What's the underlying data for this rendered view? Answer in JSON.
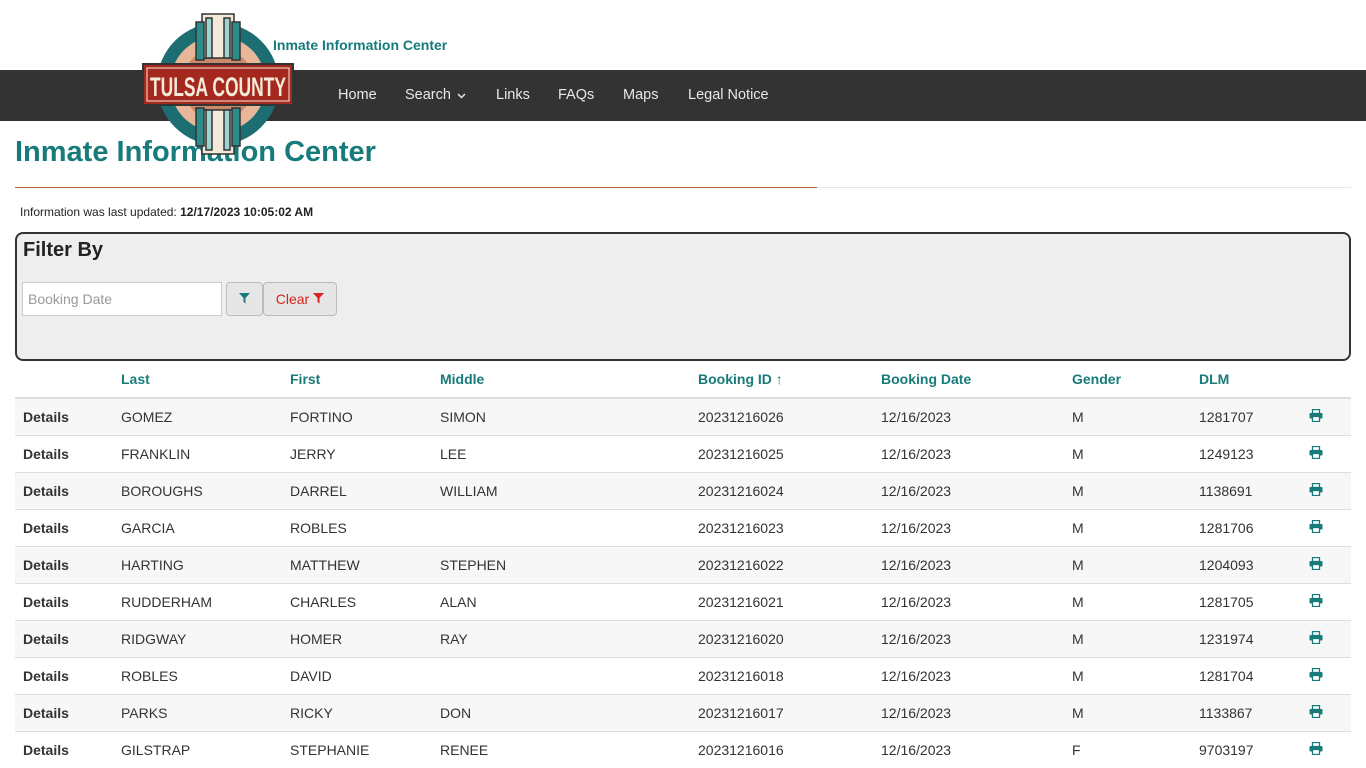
{
  "header": {
    "site_name": "Inmate Information Center",
    "logo_text": "TULSA COUNTY"
  },
  "nav": {
    "items": [
      {
        "label": "Home"
      },
      {
        "label": "Search"
      },
      {
        "label": "Links"
      },
      {
        "label": "FAQs"
      },
      {
        "label": "Maps"
      },
      {
        "label": "Legal Notice"
      }
    ]
  },
  "page": {
    "title": "Inmate Information Center",
    "updated_label": "Information was last updated:",
    "updated_value": "12/17/2023 10:05:02 AM"
  },
  "filter": {
    "title": "Filter By",
    "date_placeholder": "Booking Date",
    "clear_label": "Clear"
  },
  "table": {
    "columns": [
      "Last",
      "First",
      "Middle",
      "Booking ID ↑",
      "Booking Date",
      "Gender",
      "DLM"
    ],
    "details_label": "Details",
    "rows": [
      {
        "last": "GOMEZ",
        "first": "FORTINO",
        "middle": "SIMON",
        "booking_id": "20231216026",
        "booking_date": "12/16/2023",
        "gender": "M",
        "dlm": "1281707"
      },
      {
        "last": "FRANKLIN",
        "first": "JERRY",
        "middle": "LEE",
        "booking_id": "20231216025",
        "booking_date": "12/16/2023",
        "gender": "M",
        "dlm": "1249123"
      },
      {
        "last": "BOROUGHS",
        "first": "DARREL",
        "middle": "WILLIAM",
        "booking_id": "20231216024",
        "booking_date": "12/16/2023",
        "gender": "M",
        "dlm": "1138691"
      },
      {
        "last": "GARCIA",
        "first": "ROBLES",
        "middle": "",
        "booking_id": "20231216023",
        "booking_date": "12/16/2023",
        "gender": "M",
        "dlm": "1281706"
      },
      {
        "last": "HARTING",
        "first": "MATTHEW",
        "middle": "STEPHEN",
        "booking_id": "20231216022",
        "booking_date": "12/16/2023",
        "gender": "M",
        "dlm": "1204093"
      },
      {
        "last": "RUDDERHAM",
        "first": "CHARLES",
        "middle": "ALAN",
        "booking_id": "20231216021",
        "booking_date": "12/16/2023",
        "gender": "M",
        "dlm": "1281705"
      },
      {
        "last": "RIDGWAY",
        "first": "HOMER",
        "middle": "RAY",
        "booking_id": "20231216020",
        "booking_date": "12/16/2023",
        "gender": "M",
        "dlm": "1231974"
      },
      {
        "last": "ROBLES",
        "first": "DAVID",
        "middle": "",
        "booking_id": "20231216018",
        "booking_date": "12/16/2023",
        "gender": "M",
        "dlm": "1281704"
      },
      {
        "last": "PARKS",
        "first": "RICKY",
        "middle": "DON",
        "booking_id": "20231216017",
        "booking_date": "12/16/2023",
        "gender": "M",
        "dlm": "1133867"
      },
      {
        "last": "GILSTRAP",
        "first": "STEPHANIE",
        "middle": "RENEE",
        "booking_id": "20231216016",
        "booking_date": "12/16/2023",
        "gender": "F",
        "dlm": "9703197"
      }
    ]
  },
  "colors": {
    "accent": "#177b7b",
    "navbar": "#333333",
    "clear": "#d9231f",
    "logo_red": "#a5281f"
  },
  "icons": {
    "filter": "funnel-icon",
    "clear": "funnel-icon",
    "row_action": "print-icon",
    "dropdown": "chevron-down-icon"
  }
}
